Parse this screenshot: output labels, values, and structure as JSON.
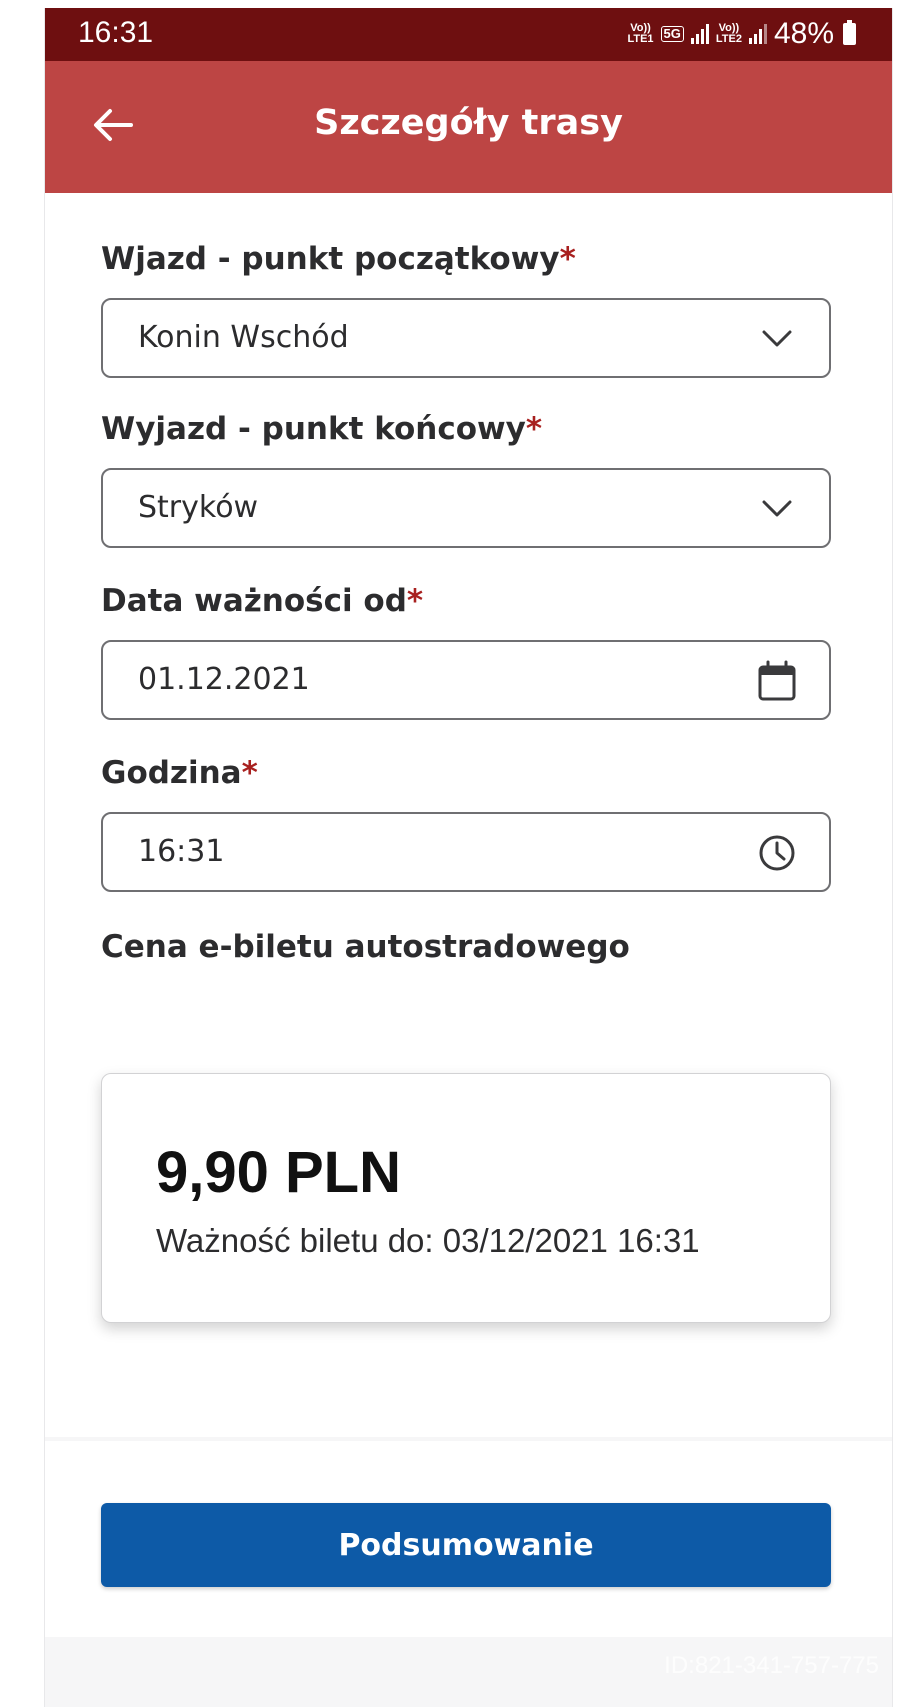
{
  "status_bar": {
    "time": "16:31",
    "sim1_label": "Vo)) LTE1",
    "network_label": "5G",
    "sim2_label": "Vo)) LTE2",
    "battery": "48%"
  },
  "app_bar": {
    "title": "Szczegóły trasy",
    "back_icon": "arrow-left-icon"
  },
  "form": {
    "entry": {
      "label": "Wjazd - punkt początkowy",
      "required_mark": "*",
      "value": "Konin Wschód",
      "icon": "chevron-down-icon"
    },
    "exit": {
      "label": "Wyjazd - punkt końcowy",
      "required_mark": "*",
      "value": "Stryków",
      "icon": "chevron-down-icon"
    },
    "valid_from": {
      "label": "Data ważności od",
      "required_mark": "*",
      "value": "01.12.2021",
      "icon": "calendar-icon"
    },
    "time": {
      "label": "Godzina",
      "required_mark": "*",
      "value": "16:31",
      "icon": "clock-icon"
    }
  },
  "price": {
    "label": "Cena e-biletu autostradowego",
    "amount": "9,90 PLN",
    "validity": "Ważność biletu do: 03/12/2021 16:31"
  },
  "actions": {
    "summary_button": "Podsumowanie"
  },
  "watermark": "ID:821-341-757-775",
  "colors": {
    "status_bar": "#6e0f10",
    "app_bar": "#bd4544",
    "required": "#a8201f",
    "primary_button": "#0d5aa7"
  }
}
